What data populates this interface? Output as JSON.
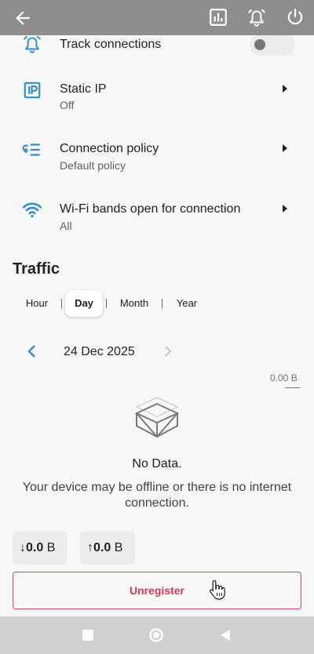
{
  "colors": {
    "accent": "#2f8fc9",
    "danger": "#d23a51",
    "topbar": "#8e8e8e"
  },
  "topbar": {
    "back_icon": "arrow-left-icon",
    "actions": [
      "bar-chart-icon",
      "alarm-bell-icon",
      "power-icon"
    ]
  },
  "settings": [
    {
      "icon": "alarm-bell-icon",
      "title": "Track connections",
      "control": "toggle",
      "toggle_on": false
    },
    {
      "icon": "ip-icon",
      "title": "Static IP",
      "subtitle": "Off"
    },
    {
      "icon": "policy-list-icon",
      "title": "Connection policy",
      "subtitle": "Default policy"
    },
    {
      "icon": "wifi-icon",
      "title": "Wi-Fi bands open for connection",
      "subtitle": "All"
    }
  ],
  "traffic": {
    "title": "Traffic",
    "tabs": [
      "Hour",
      "Day",
      "Month",
      "Year"
    ],
    "active_tab": "Day",
    "date": "24 Dec 2025",
    "scale_label": "0.00 B",
    "empty_title": "No Data.",
    "empty_description": "Your device may be offline or there is no internet connection.",
    "download": {
      "arrow": "↓",
      "value": "0.0",
      "unit": "B"
    },
    "upload": {
      "arrow": "↑",
      "value": "0.0",
      "unit": "B"
    }
  },
  "unregister_label": "Unregister"
}
